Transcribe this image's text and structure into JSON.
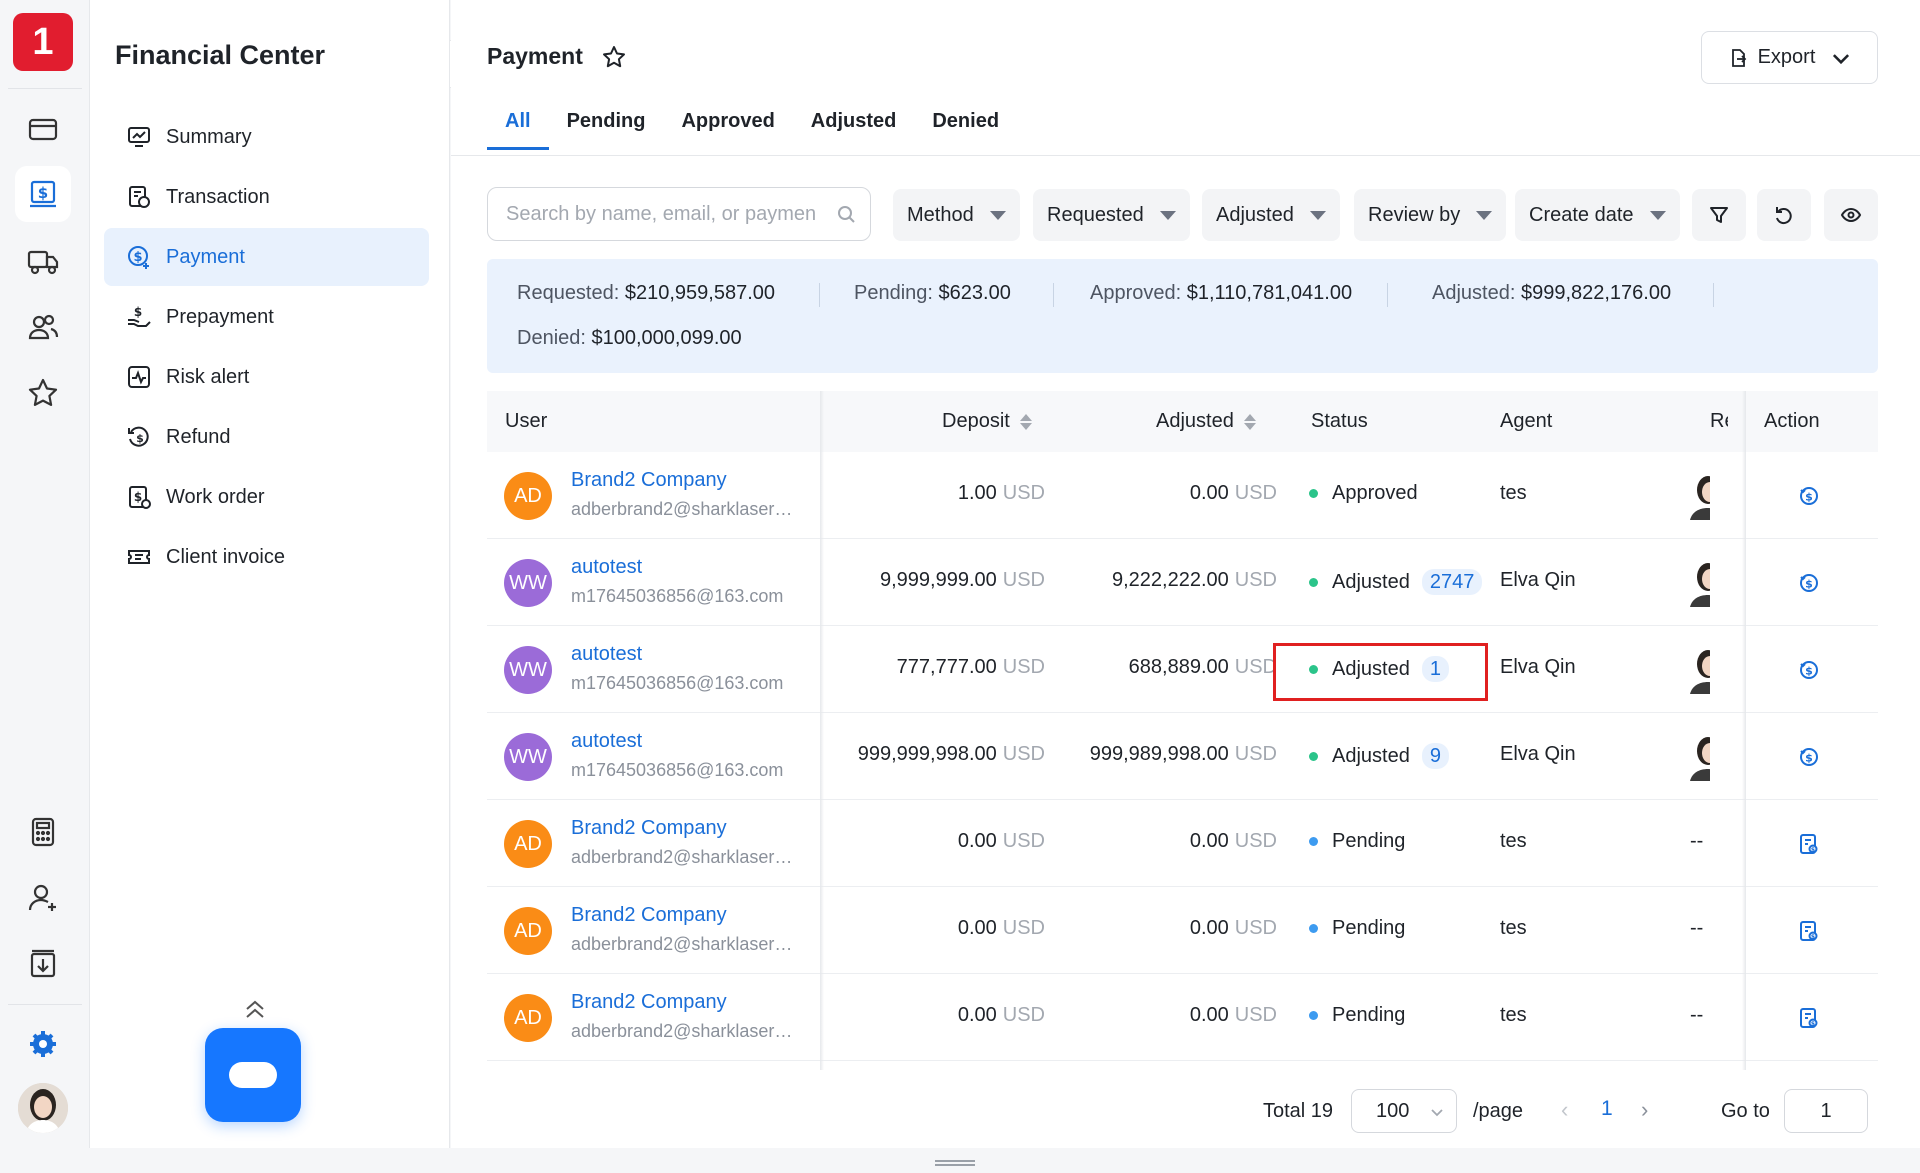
{
  "app": {
    "logo_text": "1",
    "section_title": "Financial Center",
    "brand_color": "#e11d2f",
    "accent": "#1a6ed8"
  },
  "rail": {
    "top_icons": [
      "card-icon",
      "dollar-document-icon",
      "truck-icon",
      "users-icon",
      "star-icon"
    ],
    "bottom_icons": [
      "calculator-icon",
      "user-add-icon",
      "download-document-icon",
      "gear-icon"
    ]
  },
  "sidebar": {
    "items": [
      {
        "label": "Summary",
        "icon": "chart-monitor-icon"
      },
      {
        "label": "Transaction",
        "icon": "transaction-icon"
      },
      {
        "label": "Payment",
        "icon": "payment-dollar-icon"
      },
      {
        "label": "Prepayment",
        "icon": "hand-dollar-icon"
      },
      {
        "label": "Risk alert",
        "icon": "pulse-icon"
      },
      {
        "label": "Refund",
        "icon": "refund-icon"
      },
      {
        "label": "Work order",
        "icon": "work-order-icon"
      },
      {
        "label": "Client invoice",
        "icon": "ticket-icon"
      }
    ]
  },
  "header": {
    "title": "Payment",
    "export_label": "Export"
  },
  "tabs": [
    "All",
    "Pending",
    "Approved",
    "Adjusted",
    "Denied"
  ],
  "search": {
    "placeholder": "Search by name, email, or paymen"
  },
  "filters": [
    "Method",
    "Requested",
    "Adjusted",
    "Review by",
    "Create date"
  ],
  "summary": {
    "requested_label": "Requested:",
    "requested_value": "$210,959,587.00",
    "pending_label": "Pending:",
    "pending_value": "$623.00",
    "approved_label": "Approved:",
    "approved_value": "$1,110,781,041.00",
    "adjusted_label": "Adjusted:",
    "adjusted_value": "$999,822,176.00",
    "denied_label": "Denied:",
    "denied_value": "$100,000,099.00"
  },
  "table": {
    "columns": {
      "user": "User",
      "deposit": "Deposit",
      "adjusted": "Adjusted",
      "status": "Status",
      "agent": "Agent",
      "reviewer": "Re",
      "action": "Action"
    },
    "rows": [
      {
        "initials": "AD",
        "avatar_color": "#fa8c16",
        "name": "Brand2 Company",
        "email": "adberbrand2@sharklasers....",
        "deposit": "1.00",
        "adjusted": "0.00",
        "currency": "USD",
        "status": "Approved",
        "status_color": "#2bc48a",
        "count": "",
        "agent": "tes",
        "reviewer": "photo",
        "action_icon": "dollar-review-icon"
      },
      {
        "initials": "WW",
        "avatar_color": "#9b6bd8",
        "name": "autotest",
        "email": "m17645036856@163.com",
        "deposit": "9,999,999.00",
        "adjusted": "9,222,222.00",
        "currency": "USD",
        "status": "Adjusted",
        "status_color": "#2bc48a",
        "count": "2747",
        "agent": "Elva Qin",
        "reviewer": "photo",
        "action_icon": "dollar-review-icon"
      },
      {
        "initials": "WW",
        "avatar_color": "#9b6bd8",
        "name": "autotest",
        "email": "m17645036856@163.com",
        "deposit": "777,777.00",
        "adjusted": "688,889.00",
        "currency": "USD",
        "status": "Adjusted",
        "status_color": "#2bc48a",
        "count": "1",
        "agent": "Elva Qin",
        "reviewer": "photo",
        "action_icon": "dollar-review-icon"
      },
      {
        "initials": "WW",
        "avatar_color": "#9b6bd8",
        "name": "autotest",
        "email": "m17645036856@163.com",
        "deposit": "999,999,998.00",
        "adjusted": "999,989,998.00",
        "currency": "USD",
        "status": "Adjusted",
        "status_color": "#2bc48a",
        "count": "9",
        "agent": "Elva Qin",
        "reviewer": "photo",
        "action_icon": "dollar-review-icon"
      },
      {
        "initials": "AD",
        "avatar_color": "#fa8c16",
        "name": "Brand2 Company",
        "email": "adberbrand2@sharklasers....",
        "deposit": "0.00",
        "adjusted": "0.00",
        "currency": "USD",
        "status": "Pending",
        "status_color": "#3d9bf0",
        "count": "",
        "agent": "tes",
        "reviewer": "--",
        "action_icon": "document-review-icon"
      },
      {
        "initials": "AD",
        "avatar_color": "#fa8c16",
        "name": "Brand2 Company",
        "email": "adberbrand2@sharklasers....",
        "deposit": "0.00",
        "adjusted": "0.00",
        "currency": "USD",
        "status": "Pending",
        "status_color": "#3d9bf0",
        "count": "",
        "agent": "tes",
        "reviewer": "--",
        "action_icon": "document-review-icon"
      },
      {
        "initials": "AD",
        "avatar_color": "#fa8c16",
        "name": "Brand2 Company",
        "email": "adberbrand2@sharklasers....",
        "deposit": "0.00",
        "adjusted": "0.00",
        "currency": "USD",
        "status": "Pending",
        "status_color": "#3d9bf0",
        "count": "",
        "agent": "tes",
        "reviewer": "--",
        "action_icon": "document-review-icon"
      }
    ]
  },
  "pagination": {
    "total_label": "Total 19",
    "page_size": "100",
    "per_page_label": "/page",
    "prev": "‹",
    "current_page": "1",
    "next": "›",
    "goto_label": "Go to",
    "goto_value": "1"
  }
}
